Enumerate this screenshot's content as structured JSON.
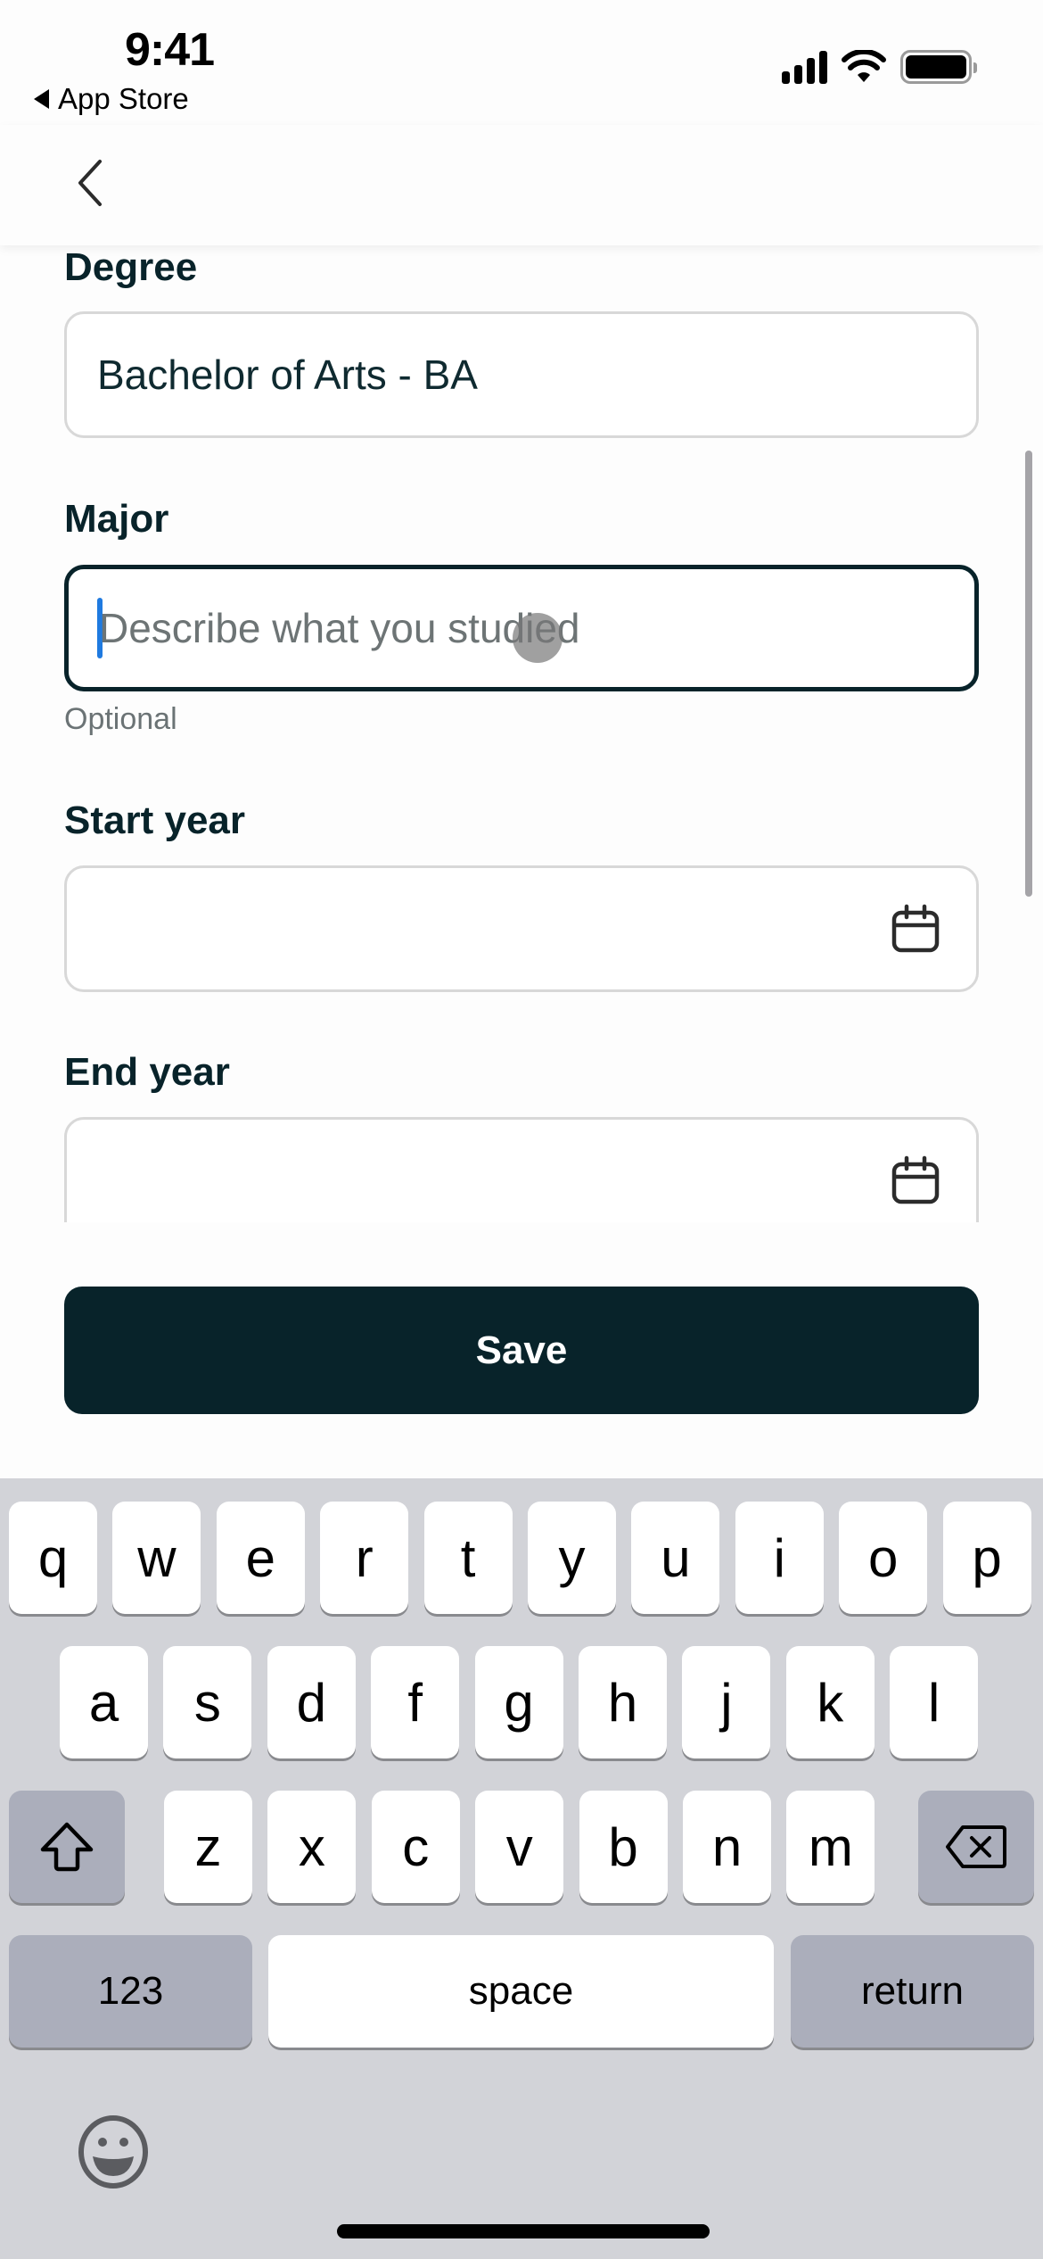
{
  "status_bar": {
    "time": "9:41",
    "back_app": "App Store",
    "icons": [
      "cellular-signal-icon",
      "wifi-icon",
      "battery-icon"
    ]
  },
  "header": {
    "back_icon": "chevron-left-icon"
  },
  "form": {
    "degree": {
      "label": "Degree",
      "value": "Bachelor of Arts - BA"
    },
    "major": {
      "label": "Major",
      "value": "",
      "placeholder": "Describe what you studied",
      "helper": "Optional",
      "focused": true
    },
    "start_year": {
      "label": "Start year",
      "value": "",
      "icon": "calendar-icon"
    },
    "end_year": {
      "label": "End year",
      "value": "",
      "icon": "calendar-icon"
    }
  },
  "actions": {
    "save_label": "Save",
    "save_color": "#08232a"
  },
  "keyboard": {
    "row1": [
      "q",
      "w",
      "e",
      "r",
      "t",
      "y",
      "u",
      "i",
      "o",
      "p"
    ],
    "row2": [
      "a",
      "s",
      "d",
      "f",
      "g",
      "h",
      "j",
      "k",
      "l"
    ],
    "row3": [
      "z",
      "x",
      "c",
      "v",
      "b",
      "n",
      "m"
    ],
    "shift_icon": "shift-icon",
    "delete_icon": "backspace-icon",
    "numbers_label": "123",
    "space_label": "space",
    "return_label": "return",
    "emoji_icon": "emoji-icon"
  },
  "colors": {
    "accent_dark": "#08232a",
    "caret": "#1f7ae0",
    "keyboard_bg": "#d2d3d8"
  }
}
